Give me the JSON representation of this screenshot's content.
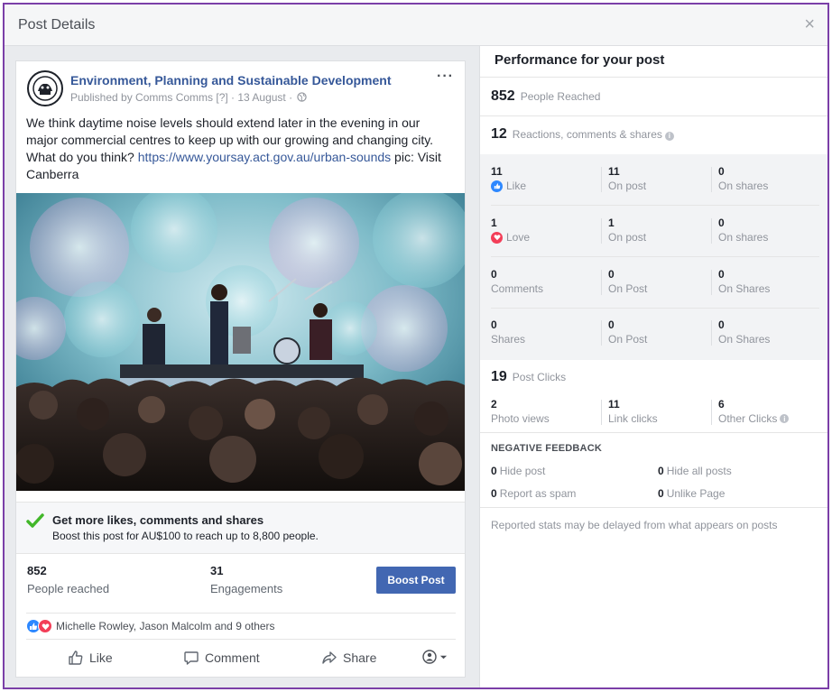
{
  "dialog": {
    "title": "Post Details",
    "close_label": "×"
  },
  "post": {
    "page_name": "Environment, Planning and Sustainable Development",
    "published_by": "Published by Comms Comms [?] · 13 August ·",
    "more_label": "···",
    "text_before_link": "We think daytime noise levels should extend later in the evening in our major commercial centres to keep up with our growing and changing city. What do you think? ",
    "link": "https://www.yoursay.act.gov.au/urban-sounds",
    "text_after_link": " pic: Visit Canberra",
    "boost_promo": {
      "title": "Get more likes, comments and shares",
      "subtitle": "Boost this post for AU$100 to reach up to 8,800 people."
    },
    "people_reached_value": "852",
    "people_reached_label": "People reached",
    "engagements_value": "31",
    "engagements_label": "Engagements",
    "boost_button": "Boost Post",
    "reactors": "Michelle Rowley, Jason Malcolm and 9 others",
    "actions": {
      "like": "Like",
      "comment": "Comment",
      "share": "Share"
    },
    "colors": {
      "accent": "#4267b2",
      "link": "#365899",
      "like_blue": "#2d88ff",
      "love_red": "#f33e58",
      "check_green": "#42b72a"
    }
  },
  "performance": {
    "title": "Performance for your post",
    "people_reached": {
      "value": "852",
      "label": "People Reached"
    },
    "reactions": {
      "value": "12",
      "label": "Reactions, comments & shares"
    },
    "grid": [
      {
        "total": "11",
        "label": "Like",
        "on_post": "11",
        "on_post_label": "On post",
        "on_shares": "0",
        "on_shares_label": "On shares",
        "icon": "like-icon"
      },
      {
        "total": "1",
        "label": "Love",
        "on_post": "1",
        "on_post_label": "On post",
        "on_shares": "0",
        "on_shares_label": "On shares",
        "icon": "love-icon"
      },
      {
        "total": "0",
        "label": "Comments",
        "on_post": "0",
        "on_post_label": "On Post",
        "on_shares": "0",
        "on_shares_label": "On Shares"
      },
      {
        "total": "0",
        "label": "Shares",
        "on_post": "0",
        "on_post_label": "On Post",
        "on_shares": "0",
        "on_shares_label": "On Shares"
      }
    ],
    "post_clicks": {
      "value": "19",
      "label": "Post Clicks"
    },
    "clicks": [
      {
        "value": "2",
        "label": "Photo views"
      },
      {
        "value": "11",
        "label": "Link clicks"
      },
      {
        "value": "6",
        "label": "Other Clicks"
      }
    ],
    "negative_title": "NEGATIVE FEEDBACK",
    "negative": [
      {
        "value": "0",
        "label": "Hide post"
      },
      {
        "value": "0",
        "label": "Hide all posts"
      },
      {
        "value": "0",
        "label": "Report as spam"
      },
      {
        "value": "0",
        "label": "Unlike Page"
      }
    ],
    "note": "Reported stats may be delayed from what appears on posts"
  }
}
